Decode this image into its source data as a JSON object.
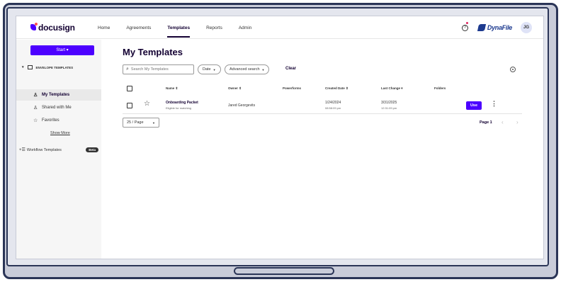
{
  "nav": {
    "logo": "docusign",
    "links": [
      "Home",
      "Agreements",
      "Templates",
      "Reports",
      "Admin"
    ],
    "active": "Templates",
    "brand": "DynaFile",
    "avatar_initials": "JG"
  },
  "sidebar": {
    "start_label": "Start ▾",
    "group_label": "ENVELOPE TEMPLATES",
    "items": [
      {
        "label": "My Templates",
        "icon": "person-icon",
        "selected": true
      },
      {
        "label": "Shared with Me",
        "icon": "people-icon",
        "selected": false
      },
      {
        "label": "Favorites",
        "icon": "star-icon",
        "selected": false
      }
    ],
    "show_more": "Show More",
    "workflow_label": "Workflow Templates",
    "beta_badge": "Beta"
  },
  "main": {
    "title": "My Templates",
    "search_placeholder": "Search My Templates",
    "date_filter": "Date",
    "advanced_search": "Advanced search",
    "clear_label": "Clear",
    "columns": [
      "Name",
      "Owner",
      "Powerforms",
      "Created Date",
      "Last Change",
      "Folders"
    ],
    "rows": [
      {
        "name": "Onboarding Packet",
        "status": "Eligible for matching",
        "owner": "Jared Georgevits",
        "created_date": "1/24/2024",
        "created_time": "08:58:09 pm",
        "last_change_date": "3/31/2025",
        "last_change_time": "12:31:09 pm",
        "action": "Use"
      }
    ],
    "page_size": "25 / Page",
    "page_label": "Page 1"
  }
}
